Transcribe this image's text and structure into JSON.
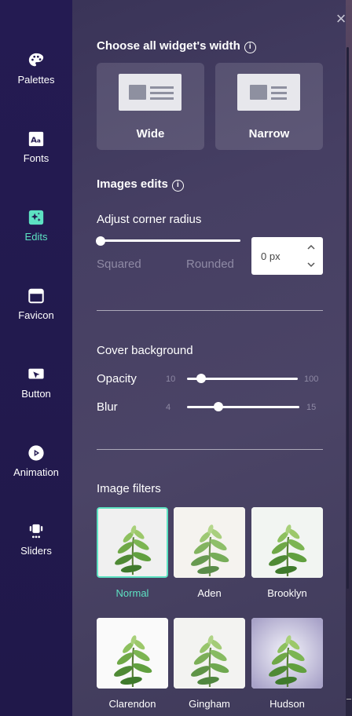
{
  "nav": {
    "items": [
      {
        "label": "Palettes",
        "icon": "palette-icon"
      },
      {
        "label": "Fonts",
        "icon": "fonts-icon"
      },
      {
        "label": "Edits",
        "icon": "sparkle-edit-icon"
      },
      {
        "label": "Favicon",
        "icon": "browser-window-icon"
      },
      {
        "label": "Button",
        "icon": "cursor-button-icon"
      },
      {
        "label": "Animation",
        "icon": "play-circle-icon"
      },
      {
        "label": "Sliders",
        "icon": "slider-carousel-icon"
      }
    ],
    "active": "Edits",
    "accent": "#5de2c2"
  },
  "width_section": {
    "title": "Choose all widget's width",
    "options": [
      {
        "label": "Wide"
      },
      {
        "label": "Narrow"
      }
    ]
  },
  "images_edits": {
    "title": "Images edits",
    "corner": {
      "label": "Adjust corner radius",
      "min_label": "Squared",
      "max_label": "Rounded",
      "value": 0,
      "value_text": "0 px"
    }
  },
  "cover": {
    "title": "Cover background",
    "opacity": {
      "label": "Opacity",
      "min": "10",
      "max": "100",
      "value": 20
    },
    "blur": {
      "label": "Blur",
      "min": "4",
      "max": "15",
      "value": 7
    }
  },
  "filters": {
    "title": "Image filters",
    "selected": "Normal",
    "items": [
      {
        "label": "Normal"
      },
      {
        "label": "Aden"
      },
      {
        "label": "Brooklyn"
      },
      {
        "label": "Clarendon"
      },
      {
        "label": "Gingham"
      },
      {
        "label": "Hudson"
      }
    ]
  }
}
